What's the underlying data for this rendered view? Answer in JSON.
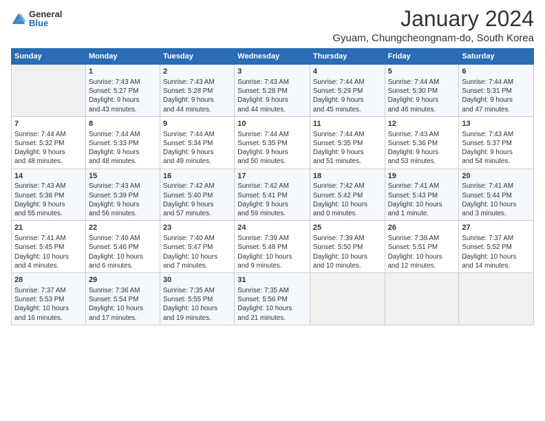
{
  "header": {
    "logo_general": "General",
    "logo_blue": "Blue",
    "month_title": "January 2024",
    "location": "Gyuam, Chungcheongnam-do, South Korea"
  },
  "days_of_week": [
    "Sunday",
    "Monday",
    "Tuesday",
    "Wednesday",
    "Thursday",
    "Friday",
    "Saturday"
  ],
  "weeks": [
    [
      {
        "day": "",
        "info": ""
      },
      {
        "day": "1",
        "info": "Sunrise: 7:43 AM\nSunset: 5:27 PM\nDaylight: 9 hours\nand 43 minutes."
      },
      {
        "day": "2",
        "info": "Sunrise: 7:43 AM\nSunset: 5:28 PM\nDaylight: 9 hours\nand 44 minutes."
      },
      {
        "day": "3",
        "info": "Sunrise: 7:43 AM\nSunset: 5:28 PM\nDaylight: 9 hours\nand 44 minutes."
      },
      {
        "day": "4",
        "info": "Sunrise: 7:44 AM\nSunset: 5:29 PM\nDaylight: 9 hours\nand 45 minutes."
      },
      {
        "day": "5",
        "info": "Sunrise: 7:44 AM\nSunset: 5:30 PM\nDaylight: 9 hours\nand 46 minutes."
      },
      {
        "day": "6",
        "info": "Sunrise: 7:44 AM\nSunset: 5:31 PM\nDaylight: 9 hours\nand 47 minutes."
      }
    ],
    [
      {
        "day": "7",
        "info": "Sunrise: 7:44 AM\nSunset: 5:32 PM\nDaylight: 9 hours\nand 48 minutes."
      },
      {
        "day": "8",
        "info": "Sunrise: 7:44 AM\nSunset: 5:33 PM\nDaylight: 9 hours\nand 48 minutes."
      },
      {
        "day": "9",
        "info": "Sunrise: 7:44 AM\nSunset: 5:34 PM\nDaylight: 9 hours\nand 49 minutes."
      },
      {
        "day": "10",
        "info": "Sunrise: 7:44 AM\nSunset: 5:35 PM\nDaylight: 9 hours\nand 50 minutes."
      },
      {
        "day": "11",
        "info": "Sunrise: 7:44 AM\nSunset: 5:35 PM\nDaylight: 9 hours\nand 51 minutes."
      },
      {
        "day": "12",
        "info": "Sunrise: 7:43 AM\nSunset: 5:36 PM\nDaylight: 9 hours\nand 53 minutes."
      },
      {
        "day": "13",
        "info": "Sunrise: 7:43 AM\nSunset: 5:37 PM\nDaylight: 9 hours\nand 54 minutes."
      }
    ],
    [
      {
        "day": "14",
        "info": "Sunrise: 7:43 AM\nSunset: 5:38 PM\nDaylight: 9 hours\nand 55 minutes."
      },
      {
        "day": "15",
        "info": "Sunrise: 7:43 AM\nSunset: 5:39 PM\nDaylight: 9 hours\nand 56 minutes."
      },
      {
        "day": "16",
        "info": "Sunrise: 7:42 AM\nSunset: 5:40 PM\nDaylight: 9 hours\nand 57 minutes."
      },
      {
        "day": "17",
        "info": "Sunrise: 7:42 AM\nSunset: 5:41 PM\nDaylight: 9 hours\nand 59 minutes."
      },
      {
        "day": "18",
        "info": "Sunrise: 7:42 AM\nSunset: 5:42 PM\nDaylight: 10 hours\nand 0 minutes."
      },
      {
        "day": "19",
        "info": "Sunrise: 7:41 AM\nSunset: 5:43 PM\nDaylight: 10 hours\nand 1 minute."
      },
      {
        "day": "20",
        "info": "Sunrise: 7:41 AM\nSunset: 5:44 PM\nDaylight: 10 hours\nand 3 minutes."
      }
    ],
    [
      {
        "day": "21",
        "info": "Sunrise: 7:41 AM\nSunset: 5:45 PM\nDaylight: 10 hours\nand 4 minutes."
      },
      {
        "day": "22",
        "info": "Sunrise: 7:40 AM\nSunset: 5:46 PM\nDaylight: 10 hours\nand 6 minutes."
      },
      {
        "day": "23",
        "info": "Sunrise: 7:40 AM\nSunset: 5:47 PM\nDaylight: 10 hours\nand 7 minutes."
      },
      {
        "day": "24",
        "info": "Sunrise: 7:39 AM\nSunset: 5:48 PM\nDaylight: 10 hours\nand 9 minutes."
      },
      {
        "day": "25",
        "info": "Sunrise: 7:39 AM\nSunset: 5:50 PM\nDaylight: 10 hours\nand 10 minutes."
      },
      {
        "day": "26",
        "info": "Sunrise: 7:38 AM\nSunset: 5:51 PM\nDaylight: 10 hours\nand 12 minutes."
      },
      {
        "day": "27",
        "info": "Sunrise: 7:37 AM\nSunset: 5:52 PM\nDaylight: 10 hours\nand 14 minutes."
      }
    ],
    [
      {
        "day": "28",
        "info": "Sunrise: 7:37 AM\nSunset: 5:53 PM\nDaylight: 10 hours\nand 16 minutes."
      },
      {
        "day": "29",
        "info": "Sunrise: 7:36 AM\nSunset: 5:54 PM\nDaylight: 10 hours\nand 17 minutes."
      },
      {
        "day": "30",
        "info": "Sunrise: 7:35 AM\nSunset: 5:55 PM\nDaylight: 10 hours\nand 19 minutes."
      },
      {
        "day": "31",
        "info": "Sunrise: 7:35 AM\nSunset: 5:56 PM\nDaylight: 10 hours\nand 21 minutes."
      },
      {
        "day": "",
        "info": ""
      },
      {
        "day": "",
        "info": ""
      },
      {
        "day": "",
        "info": ""
      }
    ]
  ]
}
